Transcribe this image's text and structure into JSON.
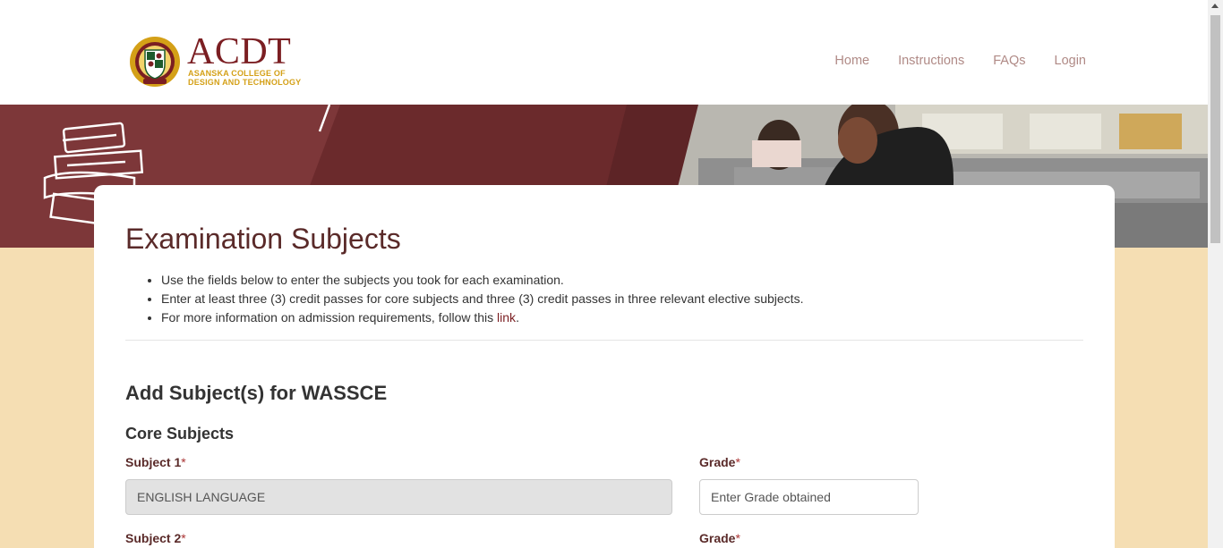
{
  "header": {
    "logo_title": "ACDT",
    "logo_sub_line1": "ASANSKA COLLEGE OF",
    "logo_sub_line2": "DESIGN AND TECHNOLOGY",
    "nav": [
      "Home",
      "Instructions",
      "FAQs",
      "Login"
    ]
  },
  "colors": {
    "brand": "#7b1e22",
    "banner": "#7d3739",
    "page_bg": "#f5deb3",
    "accent_gold": "#d4a017"
  },
  "main": {
    "title": "Examination Subjects",
    "instructions": [
      "Use the fields below to enter the subjects you took for each examination.",
      "Enter at least three (3) credit passes for core subjects and three (3) credit passes in three relevant elective subjects."
    ],
    "instruction_3_pre": "For more information on admission requirements, follow this ",
    "instruction_3_link": "link",
    "instruction_3_post": ".",
    "section_title": "Add Subject(s) for WASSCE",
    "core_title": "Core Subjects",
    "required_mark": "*",
    "subject1_label": "Subject 1",
    "subject1_value": "ENGLISH LANGUAGE",
    "grade_label": "Grade",
    "grade_placeholder": "Enter Grade obtained",
    "subject2_label": "Subject 2"
  },
  "icons": [
    "college-crest-icon",
    "books-icon"
  ]
}
